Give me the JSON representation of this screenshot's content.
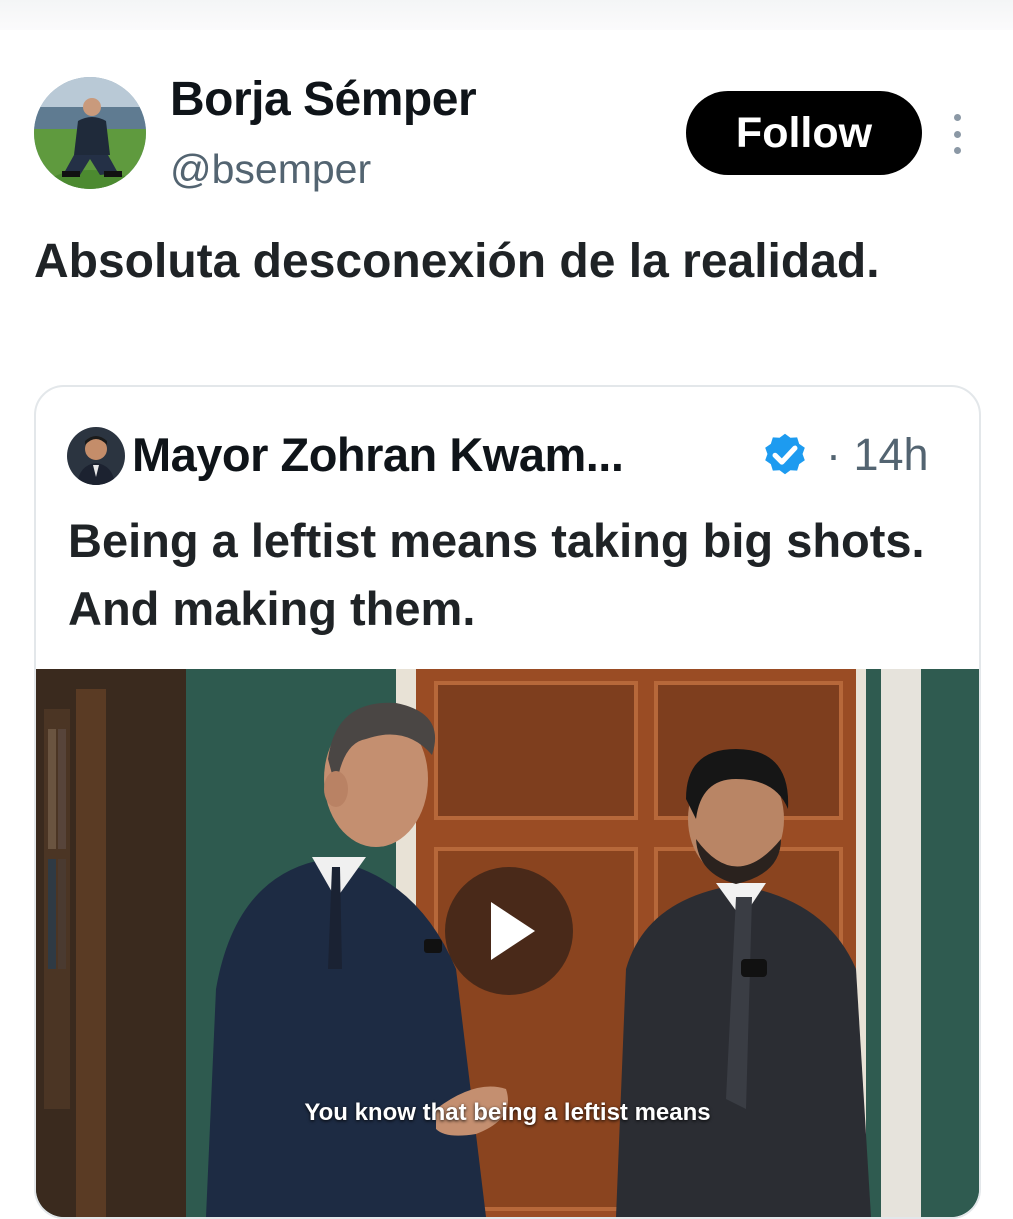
{
  "tweet": {
    "author_name": "Borja Sémper",
    "author_handle": "@bsemper",
    "follow_label": "Follow",
    "text": "Absoluta desconexión de la realidad."
  },
  "quoted_tweet": {
    "author_name": "Mayor Zohran Kwam...",
    "verified_icon": "verified-badge-icon",
    "time": "· 14h",
    "text": "Being a leftist means taking big shots. And making them.",
    "video": {
      "caption": "You know that being a leftist means",
      "play_icon": "play-icon"
    }
  },
  "colors": {
    "follow_bg": "#000000",
    "handle": "#536471",
    "verified": "#1d9bf0",
    "border": "#e3e7ea"
  }
}
